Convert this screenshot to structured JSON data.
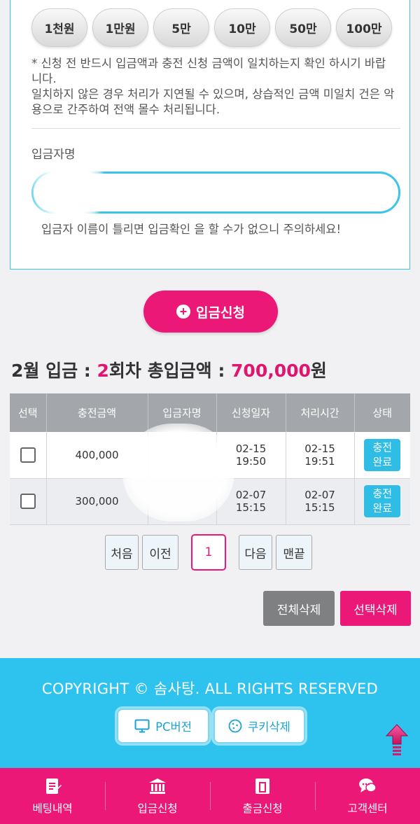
{
  "amount_buttons": [
    "1천원",
    "1만원",
    "5만",
    "10만",
    "50만",
    "100만"
  ],
  "notice": {
    "line1": "* 신청 전 반드시 입금액과 충전 신청 금액이 일치하는지 확인 하시기 바랍니다.",
    "line2": "일치하지 않은 경우 처리가 지연될 수 있으며, 상습적인 금액 미일치 건은 악용으로 간주하여 전액 몰수 처리됩니다."
  },
  "depositor": {
    "label": "입금자명",
    "value": "",
    "warning": "입금자 이름이 틀리면 입금확인 을 할 수가 없으니 주의하세요!"
  },
  "deposit_request_label": "입금신청",
  "summary": {
    "month": "2월 입금 : ",
    "count": "2",
    "count_suffix": "회차 총입금액 : ",
    "total": "700,000",
    "total_suffix": "원"
  },
  "table": {
    "headers": [
      "선택",
      "충전금액",
      "입금자명",
      "신청일자",
      "처리시간",
      "상태"
    ],
    "rows": [
      {
        "amount": "400,000",
        "depositor": "",
        "request_date": "02-15",
        "request_time": "19:50",
        "process_date": "02-15",
        "process_time": "19:51",
        "status_l1": "충전",
        "status_l2": "완료"
      },
      {
        "amount": "300,000",
        "depositor": "",
        "request_date": "02-07",
        "request_time": "15:15",
        "process_date": "02-07",
        "process_time": "15:15",
        "status_l1": "충전",
        "status_l2": "완료"
      }
    ]
  },
  "pager": {
    "first": "처음",
    "prev": "이전",
    "current": "1",
    "next": "다음",
    "last": "맨끝"
  },
  "actions": {
    "delete_all": "전체삭제",
    "delete_selected": "선택삭제"
  },
  "footer": {
    "copyright": "COPYRIGHT © 솜사탕. ALL RIGHTS RESERVED",
    "pc_version": "PC버전",
    "cookie_delete": "쿠키삭제"
  },
  "bottom_nav": [
    {
      "label": "베팅내역",
      "icon": "document-icon"
    },
    {
      "label": "입금신청",
      "icon": "bank-icon"
    },
    {
      "label": "출금신청",
      "icon": "atm-icon"
    },
    {
      "label": "고객센터",
      "icon": "chat-icon"
    }
  ],
  "colors": {
    "accent_pink": "#ec1878",
    "accent_cyan": "#2ec3ee",
    "header_gray": "#a3a6aa"
  }
}
